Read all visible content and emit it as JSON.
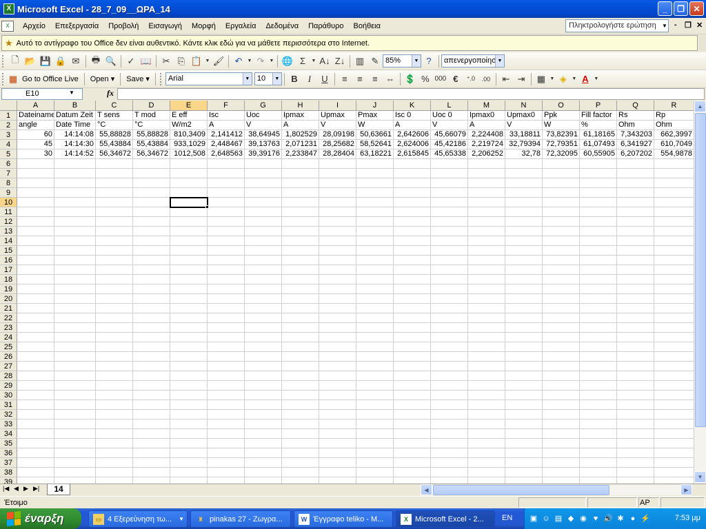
{
  "window": {
    "title": "Microsoft Excel - 28_7_09__ΩΡΑ_14",
    "icon": "excel-icon"
  },
  "menu": {
    "items": [
      "Αρχείο",
      "Επεξεργασία",
      "Προβολή",
      "Εισαγωγή",
      "Μορφή",
      "Εργαλεία",
      "Δεδομένα",
      "Παράθυρο",
      "Βοήθεια"
    ],
    "help_placeholder": "Πληκτρολογήστε ερώτηση"
  },
  "infobar": {
    "text": "Αυτό το αντίγραφο του Office δεν είναι αυθεντικό. Κάντε κλικ εδώ για να μάθετε περισσότερα στο Internet."
  },
  "toolbar": {
    "zoom": "85%",
    "style_combo": "απενεργοποίησ",
    "office_live": "Go to Office Live",
    "open": "Open",
    "save": "Save",
    "font": "Arial",
    "font_size": "10",
    "bold": "B",
    "italic": "I",
    "underline": "U",
    "percent": "%",
    "thousands": "000",
    "euro": "€",
    "fx": "fx"
  },
  "formula": {
    "namebox": "E10",
    "value": ""
  },
  "grid": {
    "columns": [
      "A",
      "B",
      "C",
      "D",
      "E",
      "F",
      "G",
      "H",
      "I",
      "J",
      "K",
      "L",
      "M",
      "N",
      "O",
      "P",
      "Q",
      "R"
    ],
    "active_col": "E",
    "active_row": 10,
    "row_count": 39,
    "rows": [
      [
        "Dateiname",
        "Datum Zeit",
        "T sens",
        "T mod",
        "E eff",
        "Isc",
        "Uoc",
        "Ipmax",
        "Upmax",
        "Pmax",
        "Isc 0",
        "Uoc 0",
        "Ipmax0",
        "Upmax0",
        "Ppk",
        "Fill factor",
        "Rs",
        "Rp"
      ],
      [
        "angle",
        "Date Time",
        "°C",
        "°C",
        "W/m2",
        "A",
        "V",
        "A",
        "V",
        "W",
        "A",
        "V",
        "A",
        "V",
        "W",
        "%",
        "Ohm",
        "Ohm"
      ],
      [
        "60",
        "14:14:08",
        "55,88828",
        "55,88828",
        "810,3409",
        "2,141412",
        "38,64945",
        "1,802529",
        "28,09198",
        "50,63661",
        "2,642606",
        "45,66079",
        "2,224408",
        "33,18811",
        "73,82391",
        "61,18165",
        "7,343203",
        "662,3997"
      ],
      [
        "45",
        "14:14:30",
        "55,43884",
        "55,43884",
        "933,1029",
        "2,448467",
        "39,13763",
        "2,071231",
        "28,25682",
        "58,52641",
        "2,624006",
        "45,42186",
        "2,219724",
        "32,79394",
        "72,79351",
        "61,07493",
        "6,341927",
        "610,7049"
      ],
      [
        "30",
        "14:14:52",
        "56,34672",
        "56,34672",
        "1012,508",
        "2,648563",
        "39,39176",
        "2,233847",
        "28,28404",
        "63,18221",
        "2,615845",
        "45,65338",
        "2,206252",
        "32,78",
        "72,32095",
        "60,55905",
        "6,207202",
        "554,9878"
      ]
    ]
  },
  "sheet": {
    "tab": "14"
  },
  "status": {
    "text": "Έτοιμο",
    "ap": "AP"
  },
  "taskbar": {
    "start": "έναρξη",
    "tasks": [
      {
        "label": "4 Εξερεύνηση τω...",
        "icon": "folder-icon"
      },
      {
        "label": "pinakas 27 - Ζωγρα...",
        "icon": "paint-icon"
      },
      {
        "label": "Έγγραφο teliko - M...",
        "icon": "word-icon"
      },
      {
        "label": "Microsoft Excel - 2...",
        "icon": "excel-icon"
      }
    ],
    "lang": "EN",
    "clock": "7:53 μμ"
  }
}
